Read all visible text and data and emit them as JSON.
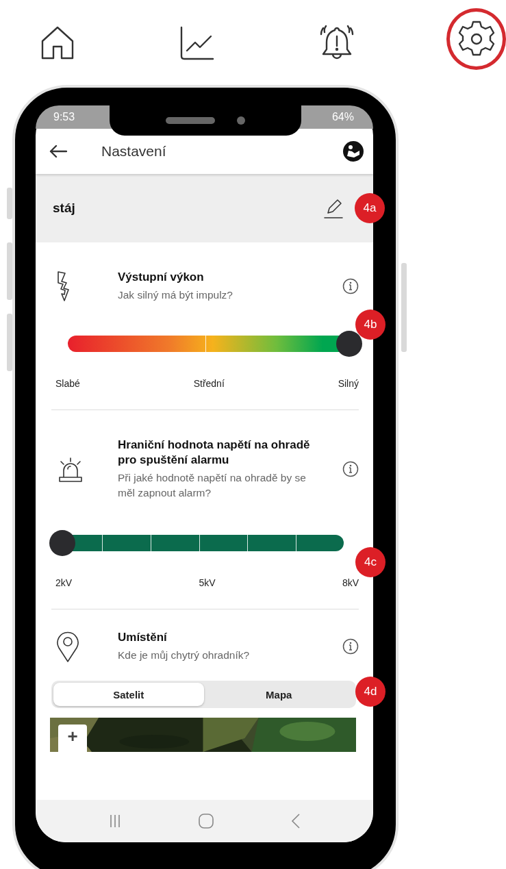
{
  "top_nav": [
    {
      "kind": "home",
      "selected": false
    },
    {
      "kind": "chart",
      "selected": false
    },
    {
      "kind": "alarm",
      "selected": false
    },
    {
      "kind": "settings",
      "selected": true
    }
  ],
  "phone": {
    "status_bar": {
      "time": "9:53",
      "battery": "64%"
    },
    "header": {
      "title": "Nastavení"
    },
    "device": {
      "name": "stáj",
      "callout": "4a"
    },
    "sections": [
      {
        "kind": "gradient_slider",
        "title": "Výstupní výkon",
        "subtitle": "Jak silný má být impulz?",
        "callout": "4b",
        "level": 1,
        "labels": [
          "Slabé",
          "Střední",
          "Silný"
        ]
      },
      {
        "kind": "step_slider",
        "title": "Hraniční hodnota napětí na ohradě pro spuštění alarmu",
        "subtitle": "Při jaké hodnotě napětí na ohradě by se měl zapnout alarm?",
        "callout": "4c",
        "level": 0,
        "labels": [
          "2kV",
          "5kV",
          "8kV"
        ]
      },
      {
        "kind": "map",
        "title": "Umístění",
        "subtitle": "Kde je můj chytrý ohradník?",
        "callout": "4d",
        "tabs": [
          {
            "label": "Satelit",
            "selected": true
          },
          {
            "label": "Mapa",
            "selected": false
          }
        ],
        "map": {
          "zoom_in": "+"
        }
      }
    ]
  }
}
